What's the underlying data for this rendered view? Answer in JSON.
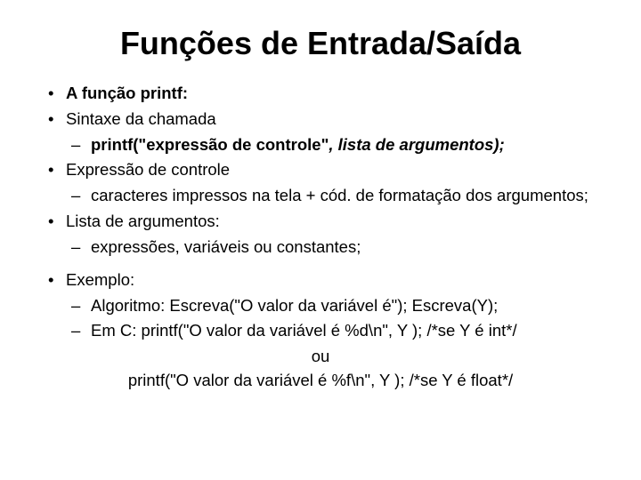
{
  "title": "Funções de Entrada/Saída",
  "b1": "A função printf:",
  "b2": "Sintaxe da chamada",
  "b2s1_a": "printf(\"expressão de controle\"",
  "b2s1_b": ", lista de argumentos);",
  "b3": "Expressão de controle",
  "b3s1": "caracteres impressos na tela + cód. de formatação dos argumentos;",
  "b4": "Lista de argumentos:",
  "b4s1": "expressões, variáveis ou constantes;",
  "b5": "Exemplo:",
  "b5s1": "Algoritmo: Escreva(\"O valor da variável é\"); Escreva(Y);",
  "b5s2": "Em C: printf(\"O valor da variável é %d\\n\", Y ); /*se Y é int*/",
  "ou": "ou",
  "last": "printf(\"O valor da variável é %f\\n\", Y ); /*se Y é float*/"
}
